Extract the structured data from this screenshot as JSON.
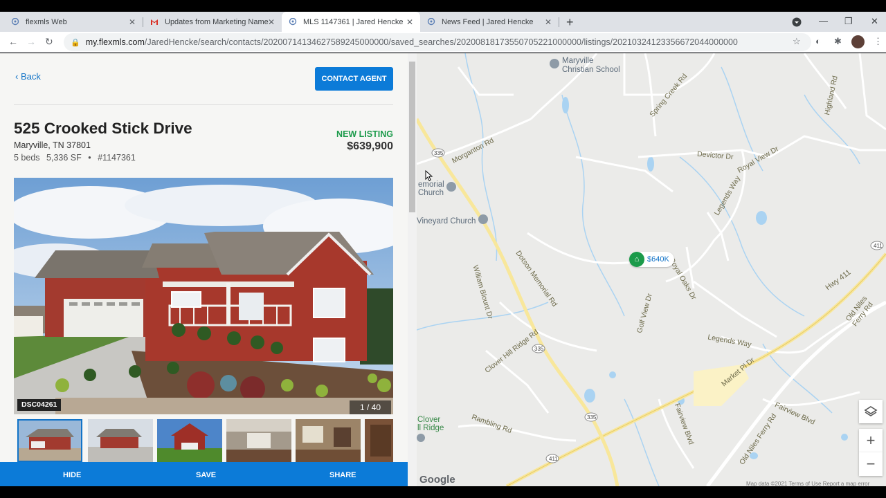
{
  "browser": {
    "tabs": [
      {
        "title": "flexmls Web",
        "icon": "flexmls-icon",
        "active": false
      },
      {
        "title": "Updates from Marketing Name F",
        "icon": "gmail-icon",
        "active": false
      },
      {
        "title": "MLS 1147361 | Jared Hencke",
        "icon": "flexmls-icon",
        "active": true
      },
      {
        "title": "News Feed | Jared Hencke",
        "icon": "flexmls-icon",
        "active": false
      }
    ],
    "url_host": "my.flexmls.com",
    "url_path": "/JaredHencke/search/contacts/20200714134627589245000000/saved_searches/20200818173550705221000000/listings/20210324123356672044000000"
  },
  "listing": {
    "back_label": "Back",
    "contact_label": "CONTACT AGENT",
    "address": "525 Crooked Stick Drive",
    "city_line": "Maryville, TN 37801",
    "beds": "5 beds",
    "sqft": "5,336 SF",
    "bullet": "•",
    "mls_number": "#1147361",
    "status": "NEW LISTING",
    "price": "$639,900",
    "photo_caption": "DSC04261",
    "photo_counter": "1 / 40",
    "actions": {
      "hide": "HIDE",
      "save": "SAVE",
      "share": "SHARE"
    }
  },
  "map": {
    "pois": [
      {
        "name": "Maryville\nChristian School"
      },
      {
        "name": "emorial\nChurch"
      },
      {
        "name": "Vineyard Church"
      },
      {
        "name": "Clover\nll Ridge"
      }
    ],
    "roads": [
      "William Blount Dr",
      "Hwy 411",
      "Old Niles Ferry Rd",
      "Morganton Rd",
      "Royal View Dr",
      "Legends Way",
      "Clover Hill Ridge Rd",
      "Fairview Blvd",
      "Dotson Memorial Rd",
      "Market Pl Dr",
      "Devictor Dr",
      "Royal Oaks Dr",
      "Golf View Dr",
      "Rambling Rd",
      "Spring Creek Rd",
      "Highland Rd"
    ],
    "shields": [
      "335",
      "335",
      "335",
      "411",
      "411"
    ],
    "pin_label": "$640K",
    "google": "Google",
    "attribution": "Map data ©2021   Terms of Use   Report a map error"
  }
}
